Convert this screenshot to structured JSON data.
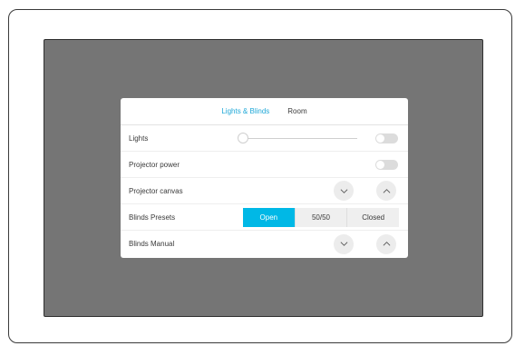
{
  "tabs": [
    {
      "label": "Lights & Blinds",
      "active": true
    },
    {
      "label": "Room",
      "active": false
    }
  ],
  "rows": {
    "lights": {
      "label": "Lights",
      "slider_level": 0.0,
      "toggle_on": false
    },
    "projector_power": {
      "label": "Projector power",
      "toggle_on": false
    },
    "projector_canvas": {
      "label": "Projector canvas"
    },
    "blinds_presets": {
      "label": "Blinds Presets",
      "options": [
        "Open",
        "50/50",
        "Closed"
      ],
      "selected": "Open"
    },
    "blinds_manual": {
      "label": "Blinds Manual"
    }
  },
  "colors": {
    "accent": "#1fa8d8",
    "selected_segment": "#00b8e6",
    "screen_background": "#757575"
  },
  "icons": {
    "down": "chevron-down-icon",
    "up": "chevron-up-icon"
  }
}
